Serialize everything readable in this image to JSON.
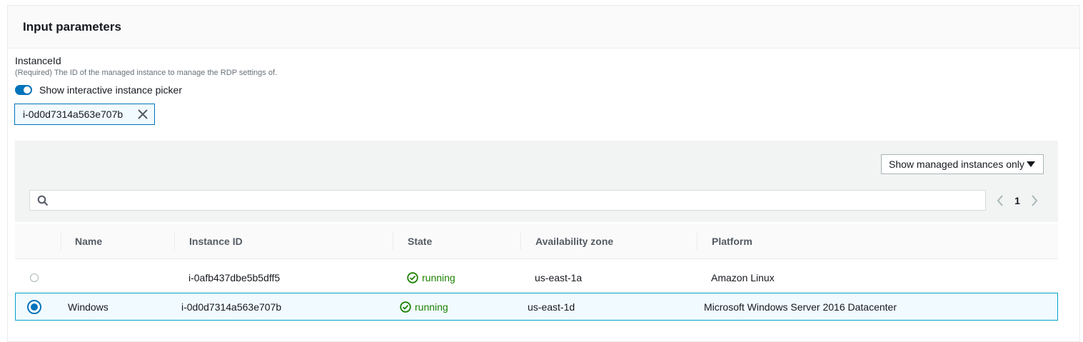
{
  "panel": {
    "title": "Input parameters"
  },
  "field": {
    "label": "InstanceId",
    "description": "(Required) The ID of the managed instance to manage the RDP settings of.",
    "toggle_label": "Show interactive instance picker",
    "toggle_on": true,
    "selected_token": "i-0d0d7314a563e707b"
  },
  "picker": {
    "filter_label": "Show managed instances only",
    "search_value": "",
    "page": "1"
  },
  "table": {
    "columns": [
      "Name",
      "Instance ID",
      "State",
      "Availability zone",
      "Platform"
    ],
    "rows": [
      {
        "selected": false,
        "name": "",
        "instance_id": "i-0afb437dbe5b5dff5",
        "state": "running",
        "az": "us-east-1a",
        "platform": "Amazon Linux"
      },
      {
        "selected": true,
        "name": "Windows",
        "instance_id": "i-0d0d7314a563e707b",
        "state": "running",
        "az": "us-east-1d",
        "platform": "Microsoft Windows Server 2016 Datacenter"
      }
    ]
  },
  "colors": {
    "accent": "#0073bb",
    "success": "#1d8102",
    "selected_border": "#00a1c9"
  }
}
